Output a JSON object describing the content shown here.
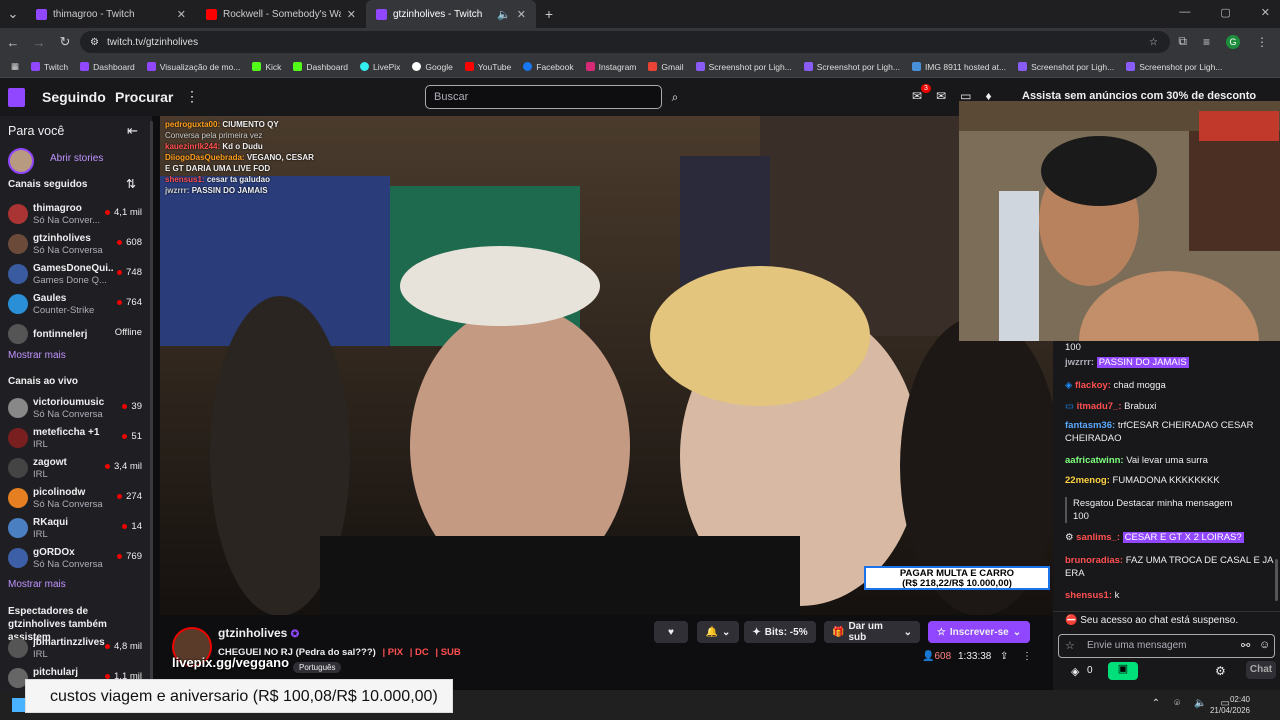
{
  "browser": {
    "tabs": [
      {
        "title": "thimagroo - Twitch",
        "favicon_color": "#9147ff",
        "active": false
      },
      {
        "title": "Rockwell - Somebody's Watchin",
        "favicon_color": "#ff0000",
        "active": false
      },
      {
        "title": "gtzinholives - Twitch",
        "favicon_color": "#9147ff",
        "active": true
      }
    ],
    "new_tab": "+",
    "url": "twitch.tv/gtzinholives",
    "bookmarks": [
      "Twitch",
      "Dashboard",
      "Visualização de mo...",
      "Kick",
      "Dashboard",
      "LivePix",
      "Google",
      "YouTube",
      "Facebook",
      "Instagram",
      "Gmail",
      "Screenshot por Ligh...",
      "Screenshot por Ligh...",
      "IMG 8911 hosted at...",
      "Screenshot por Ligh...",
      "Screenshot por Ligh..."
    ]
  },
  "twitch": {
    "nav_following": "Seguindo",
    "nav_browse": "Procurar",
    "search_placeholder": "Buscar",
    "notif_count": "3",
    "promo": "Assista sem anúncios com 30% de desconto"
  },
  "sidebar": {
    "for_you": "Para você",
    "stories": "Abrir stories",
    "followed_header": "Canais seguidos",
    "followed": [
      {
        "name": "thimagroo",
        "category": "Só Na Conver...",
        "viewers": "4,1 mil"
      },
      {
        "name": "gtzinholives",
        "category": "Só Na Conversa",
        "viewers": "608"
      },
      {
        "name": "GamesDoneQui...",
        "category": "Games Done Q...",
        "viewers": "748"
      },
      {
        "name": "Gaules",
        "category": "Counter-Strike",
        "viewers": "764"
      },
      {
        "name": "fontinnelerj",
        "category": "",
        "viewers": "Offline"
      }
    ],
    "show_more": "Mostrar mais",
    "live_header": "Canais ao vivo",
    "live": [
      {
        "name": "victorioumusic",
        "category": "Só Na Conversa",
        "viewers": "39"
      },
      {
        "name": "meteficcha +1",
        "category": "IRL",
        "viewers": "51"
      },
      {
        "name": "zagowt",
        "category": "IRL",
        "viewers": "3,4 mil"
      },
      {
        "name": "picolinodw",
        "category": "Só Na Conversa",
        "viewers": "274"
      },
      {
        "name": "RKaqui",
        "category": "IRL",
        "viewers": "14"
      },
      {
        "name": "gORDOx",
        "category": "Só Na Conversa",
        "viewers": "769"
      }
    ],
    "show_more2": "Mostrar mais",
    "also_header": "Espectadores de gtzinholives também assistem",
    "also": [
      {
        "name": "jbmartinzzlives",
        "category": "IRL",
        "viewers": "4,8 mil"
      },
      {
        "name": "pitchularj",
        "category": "",
        "viewers": "1,1 mil"
      }
    ]
  },
  "video": {
    "overlay_chat": [
      {
        "user": "pedroguxta00:",
        "text": "CIUMENTO QY",
        "color": "#ff9f1c"
      },
      {
        "user": "",
        "text": "Conversa pela primeira vez",
        "color": "#cccccc"
      },
      {
        "user": "kauezinrlk244:",
        "text": "Kd o Dudu",
        "color": "#ff4d4d"
      },
      {
        "user": "DiiogoDasQuebrada:",
        "text": "VEGANO, CESAR",
        "color": "#ff9f1c"
      },
      {
        "user": "",
        "text": "E GT DARIA UMA LIVE FOD",
        "color": "#ffffff"
      },
      {
        "user": "shensus1:",
        "text": "cesar ta galudao",
        "color": "#ff4d4d"
      },
      {
        "user": "jwzrrr:",
        "text": "PASSIN DO JAMAIS",
        "color": "#cccccc"
      }
    ],
    "overlay_line1": "PAGAR MULTA E CARRO",
    "overlay_line2": "(R$ 218,22/R$ 10.000,00)"
  },
  "stream": {
    "streamer": "gtzinholives",
    "title": "CHEGUEI NO RJ (Pedra do sal???)",
    "links": [
      "| PIX",
      "| DC",
      "| SUB"
    ],
    "tag": "Português",
    "livepix": "livepix.gg/veggano",
    "bits": "Bits: -5%",
    "gift": "Dar um sub",
    "subscribe": "Inscrever-se",
    "viewers": "608",
    "uptime": "1:33:38"
  },
  "chat": {
    "messages": [
      {
        "user": "",
        "text": "100",
        "color": "#efeff1"
      },
      {
        "user": "jwzrrr:",
        "text": "PASSIN DO JAMAIS",
        "color": "#adadb8",
        "hl": true
      },
      {
        "user": "flackoy:",
        "text": "chad mogga",
        "color": "#ff4f4f"
      },
      {
        "user": "itmadu7_:",
        "text": "Brabuxi",
        "color": "#ff4f4f"
      },
      {
        "user": "fantasm36:",
        "text": "trfCESAR CHEIRADAO CESAR CHEIRADAO",
        "color": "#5aa9ff"
      },
      {
        "user": "aafricatwinn:",
        "text": "Vai levar uma surra",
        "color": "#7dff7d"
      },
      {
        "user": "22menog:",
        "text": "FUMADONA KKKKKKKK",
        "color": "#ffd23f"
      },
      {
        "user": "",
        "text": "Resgatou Destacar minha mensagem",
        "color": "#efeff1"
      },
      {
        "user": "",
        "text": "100",
        "color": "#efeff1"
      },
      {
        "user": "sanlims_:",
        "text": "CESAR E GT X 2 LOIRAS?",
        "color": "#ff4f4f",
        "hl": true
      },
      {
        "user": "brunoradias:",
        "text": "FAZ UMA TROCA DE CASAL E JA ERA",
        "color": "#ff4f4f"
      },
      {
        "user": "shensus1:",
        "text": "k",
        "color": "#ff4f4f"
      }
    ],
    "suspended": "Seu acesso ao chat está suspenso.",
    "placeholder": "Envie uma mensagem",
    "points": "0",
    "chat_button": "Chat"
  },
  "donation": "custos viagem e aniversario (R$ 100,08/R$ 10.000,00)",
  "taskbar": {
    "time": "02:40",
    "date": "21/04/2026"
  }
}
